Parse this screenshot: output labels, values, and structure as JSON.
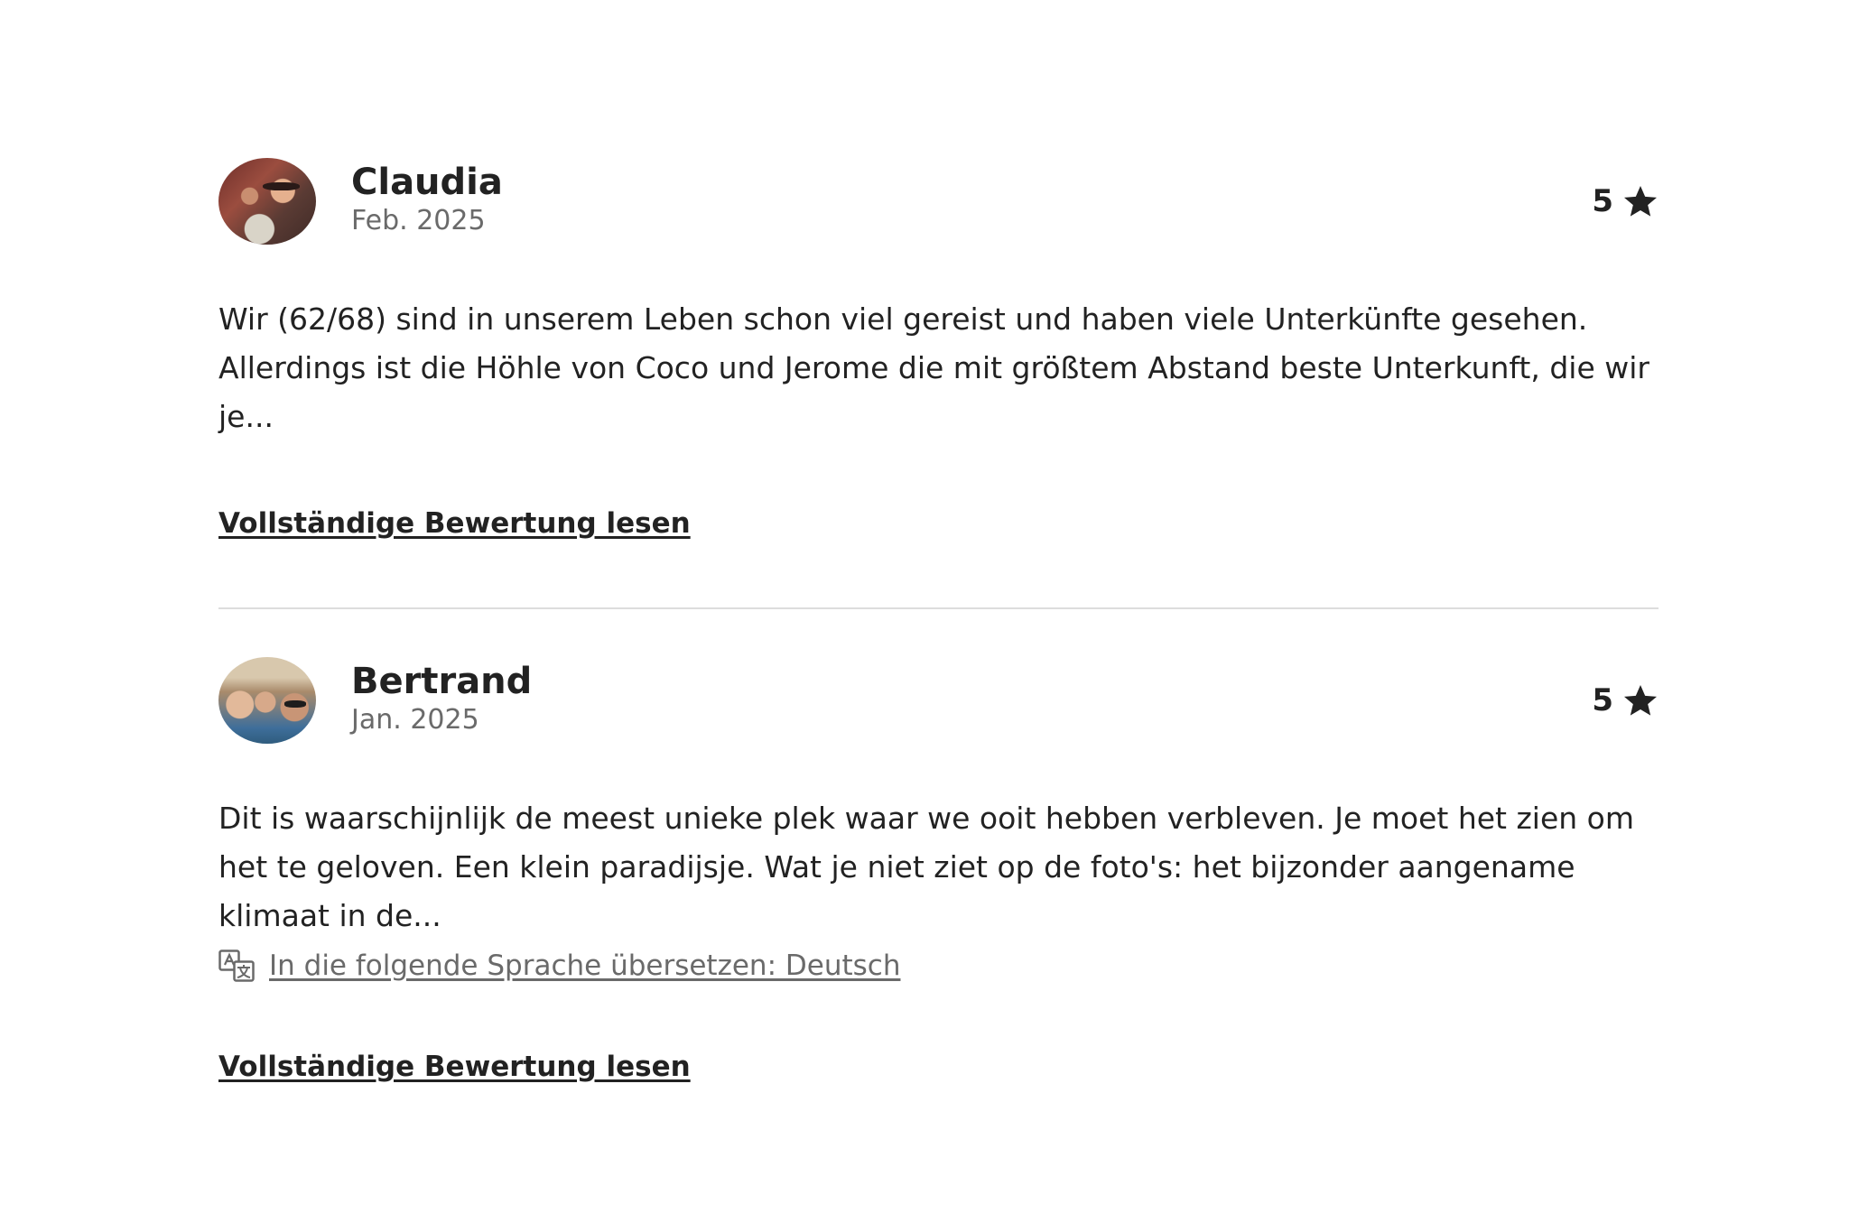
{
  "reviews": [
    {
      "name": "Claudia",
      "date": "Feb. 2025",
      "rating": "5",
      "text": "Wir (62/68) sind in unserem Leben schon viel gereist und haben viele Unterkünfte gesehen. Allerdings ist die Höhle von Coco und Jerome die mit größtem Abstand beste Unterkunft, die wir je...",
      "read_more": "Vollständige Bewertung lesen"
    },
    {
      "name": "Bertrand",
      "date": "Jan. 2025",
      "rating": "5",
      "text": "Dit is waarschijnlijk de meest unieke plek waar we ooit hebben verbleven. Je moet het zien om het te geloven. Een klein paradijsje. Wat je niet ziet op de foto's: het bijzonder aangename klimaat in de...",
      "translate": "In die folgende Sprache übersetzen: Deutsch",
      "read_more": "Vollständige Bewertung lesen"
    }
  ],
  "icons": {
    "rating": "star-icon",
    "translate": "translate-icon"
  },
  "colors": {
    "text_primary": "#222222",
    "text_secondary": "#6a6a6a",
    "divider": "#dddddd"
  }
}
